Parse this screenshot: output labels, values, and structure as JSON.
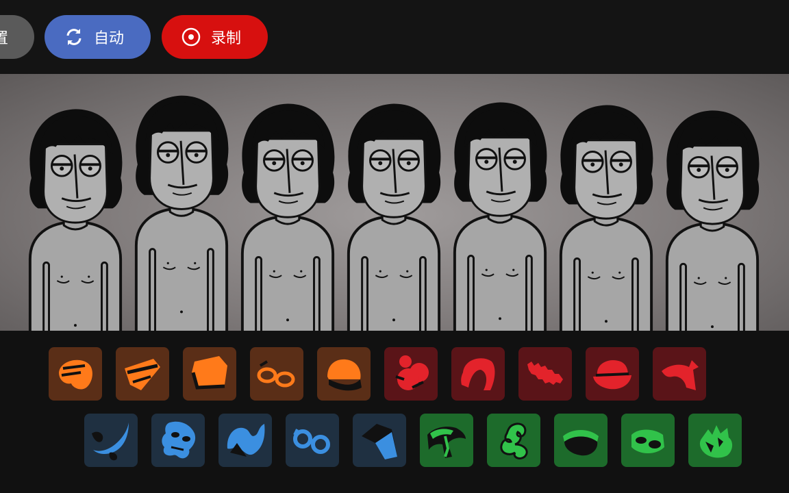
{
  "toolbar": {
    "reset_label": "置",
    "auto_label": "自动",
    "record_label": "录制",
    "colors": {
      "reset": "#5a5a5a",
      "auto": "#4a6bc1",
      "record": "#d7100f"
    }
  },
  "stage": {
    "character_count": 7,
    "state": "idle"
  },
  "sound_tray": {
    "row1": [
      {
        "category": "beats",
        "color": "#ff7a1a",
        "icon": "cap-icon"
      },
      {
        "category": "beats",
        "color": "#ff7a1a",
        "icon": "headband-icon"
      },
      {
        "category": "beats",
        "color": "#ff7a1a",
        "icon": "visor-icon"
      },
      {
        "category": "beats",
        "color": "#ff7a1a",
        "icon": "sunglasses-icon"
      },
      {
        "category": "beats",
        "color": "#ff7a1a",
        "icon": "beanie-icon"
      },
      {
        "category": "effects",
        "color": "#e3232b",
        "icon": "mouse-ears-icon"
      },
      {
        "category": "effects",
        "color": "#e3232b",
        "icon": "hood-icon"
      },
      {
        "category": "effects",
        "color": "#e3232b",
        "icon": "mustache-icon"
      },
      {
        "category": "effects",
        "color": "#e3232b",
        "icon": "bowler-hat-icon"
      },
      {
        "category": "effects",
        "color": "#e3232b",
        "icon": "pirate-hat-icon"
      }
    ],
    "row2": [
      {
        "category": "melodies",
        "color": "#3b8fe0",
        "icon": "crescent-icon"
      },
      {
        "category": "melodies",
        "color": "#3b8fe0",
        "icon": "mask-icon"
      },
      {
        "category": "melodies",
        "color": "#3b8fe0",
        "icon": "wave-hat-icon"
      },
      {
        "category": "melodies",
        "color": "#3b8fe0",
        "icon": "round-glasses-icon"
      },
      {
        "category": "melodies",
        "color": "#3b8fe0",
        "icon": "square-hat-icon"
      },
      {
        "category": "voices",
        "color": "#31c24a",
        "icon": "palm-icon"
      },
      {
        "category": "voices",
        "color": "#31c24a",
        "icon": "curl-icon"
      },
      {
        "category": "voices",
        "color": "#31c24a",
        "icon": "bandana-icon"
      },
      {
        "category": "voices",
        "color": "#31c24a",
        "icon": "goggles-icon"
      },
      {
        "category": "voices",
        "color": "#31c24a",
        "icon": "crown-icon"
      }
    ]
  }
}
